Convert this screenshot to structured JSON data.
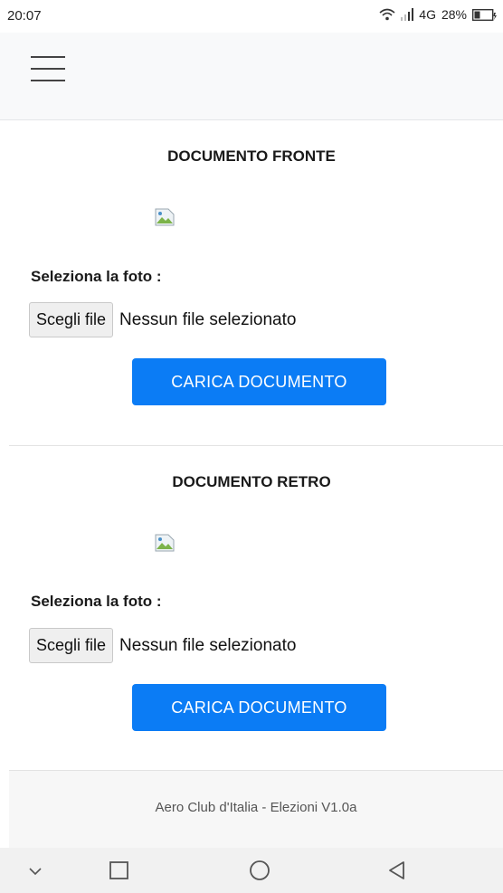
{
  "status_bar": {
    "time": "20:07",
    "network": "4G",
    "battery": "28%"
  },
  "navbar": {
    "menu_icon": "hamburger-menu-icon"
  },
  "sections": [
    {
      "title": "DOCUMENTO FRONTE",
      "image_icon": "broken-image-icon",
      "field_label": "Seleziona la foto :",
      "file_button_label": "Scegli file",
      "file_status": "Nessun file selezionato",
      "upload_button_label": "CARICA DOCUMENTO"
    },
    {
      "title": "DOCUMENTO RETRO",
      "image_icon": "broken-image-icon",
      "field_label": "Seleziona la foto :",
      "file_button_label": "Scegli file",
      "file_status": "Nessun file selezionato",
      "upload_button_label": "CARICA DOCUMENTO"
    }
  ],
  "footer": {
    "text": "Aero Club d'Italia - Elezioni V1.0a"
  },
  "android_nav": {
    "items": [
      "chevron-down-icon",
      "recents-square-icon",
      "home-circle-icon",
      "back-triangle-icon"
    ]
  },
  "colors": {
    "primary_button": "#0b7cf5",
    "navbar_bg": "#f8f9fa",
    "footer_bg": "#f7f7f7"
  }
}
